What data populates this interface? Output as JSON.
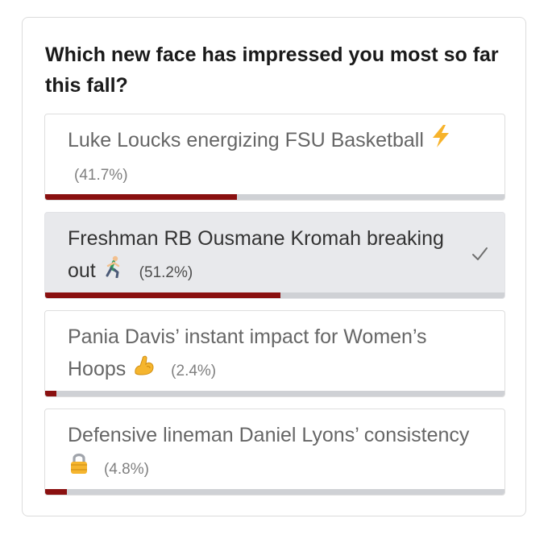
{
  "poll": {
    "question": "Which new face has impressed you most so far this fall?",
    "accent_color": "#8a1010",
    "selected_index": 1,
    "options": [
      {
        "text": "Luke Loucks energizing FSU Basketball",
        "icon": "lightning-bolt-icon",
        "percent_label": "(41.7%)",
        "percent": 41.7,
        "selected": false
      },
      {
        "text": "Freshman RB Ousmane Kromah breaking out",
        "icon": "running-man-icon",
        "percent_label": "(51.2%)",
        "percent": 51.2,
        "selected": true
      },
      {
        "text": "Pania Davis’ instant impact for Women’s Hoops",
        "icon": "flexed-biceps-icon",
        "percent_label": "(2.4%)",
        "percent": 2.4,
        "selected": false
      },
      {
        "text": "Defensive lineman Daniel Lyons’ consistency",
        "icon": "lock-icon",
        "percent_label": "(4.8%)",
        "percent": 4.8,
        "selected": false
      }
    ]
  }
}
